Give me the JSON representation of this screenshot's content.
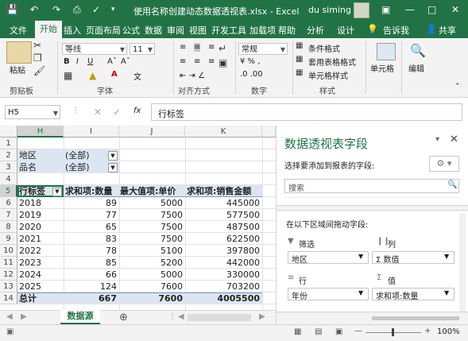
{
  "window": {
    "title": "使用名称创建动态数据透视表.xlsx - Excel",
    "user": "du siming"
  },
  "ribbon_tabs": [
    "文件",
    "开始",
    "插入",
    "页面布局",
    "公式",
    "数据",
    "审阅",
    "视图",
    "开发工具",
    "加载项",
    "帮助",
    "分析",
    "设计"
  ],
  "ribbon_active_tab": "开始",
  "tell_me": "告诉我",
  "share": "共享",
  "ribbon": {
    "paste": "粘贴",
    "clipboard_group": "剪贴板",
    "font_name": "等线",
    "font_size": "11",
    "font_group": "字体",
    "align_group": "对齐方式",
    "number_format": "常规",
    "number_group": "数字",
    "cond_format": "条件格式",
    "table_format": "套用表格格式",
    "cell_styles": "单元格样式",
    "style_group": "样式",
    "cells_btn": "单元格",
    "edit_btn": "编辑"
  },
  "formula_bar": {
    "name_box": "H5",
    "fx": "fx",
    "content": "行标签"
  },
  "grid": {
    "columns": [
      "H",
      "I",
      "J",
      "K"
    ],
    "selected_column": "H",
    "rows": [
      "1",
      "2",
      "3",
      "4",
      "5",
      "6",
      "7",
      "8",
      "9",
      "10",
      "11",
      "12",
      "13",
      "14"
    ],
    "selected_row": "5",
    "filters": [
      {
        "label": "地区",
        "value": "(全部)"
      },
      {
        "label": "品名",
        "value": "(全部)"
      }
    ],
    "header": [
      "行标签",
      "求和项:数量",
      "最大值项:单价",
      "求和项:销售金额"
    ],
    "data": [
      [
        "2018",
        "89",
        "5000",
        "445000"
      ],
      [
        "2019",
        "77",
        "7500",
        "577500"
      ],
      [
        "2020",
        "65",
        "7500",
        "487500"
      ],
      [
        "2021",
        "83",
        "7500",
        "622500"
      ],
      [
        "2022",
        "78",
        "5100",
        "397800"
      ],
      [
        "2023",
        "85",
        "5200",
        "442000"
      ],
      [
        "2024",
        "66",
        "5000",
        "330000"
      ],
      [
        "2025",
        "124",
        "7600",
        "703200"
      ]
    ],
    "total": [
      "总计",
      "667",
      "7600",
      "4005500"
    ]
  },
  "sheet_tab": "数据源",
  "pivot_pane": {
    "title": "数据透视表字段",
    "subtitle": "选择要添加到报表的字段:",
    "search_placeholder": "搜索",
    "drag_hint": "在以下区域间拖动字段:",
    "filters_label": "筛选",
    "columns_label": "列",
    "rows_label": "行",
    "values_label": "值",
    "filters_item": "地区",
    "columns_item": "Σ 数值",
    "rows_item": "年份",
    "values_item": "求和项:数量"
  },
  "status": {
    "zoom": "100%"
  }
}
